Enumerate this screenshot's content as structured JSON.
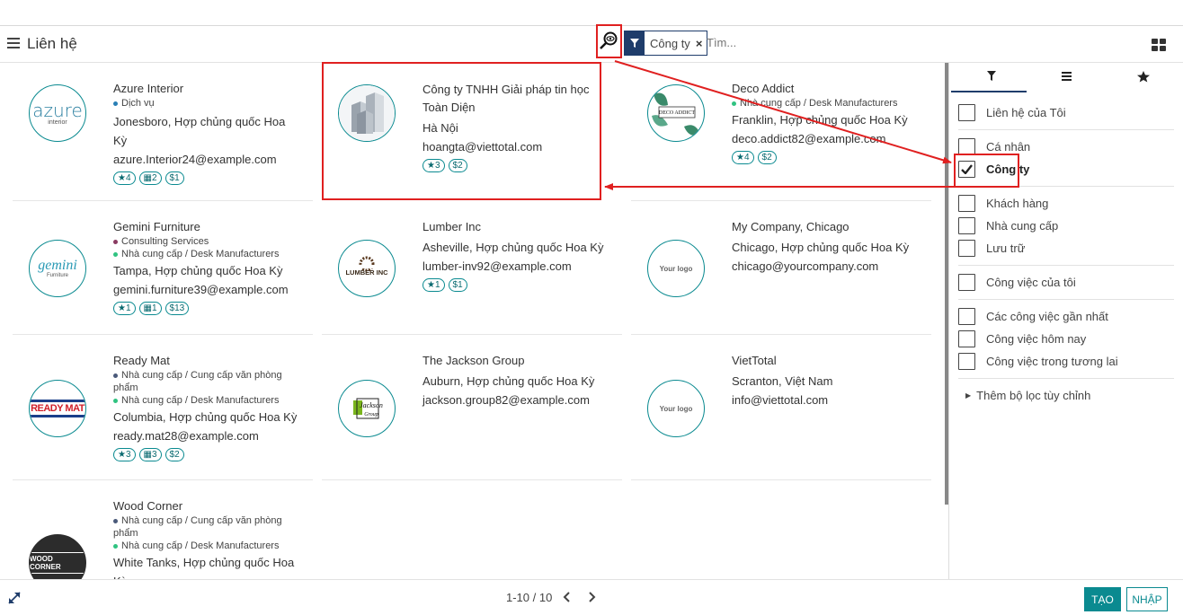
{
  "app": {
    "title": "Liên hệ"
  },
  "search": {
    "facet_label": "Công ty",
    "facet_remove": "×",
    "placeholder": "Tìm..."
  },
  "cards": [
    {
      "name": "Azure Interior",
      "tags": [
        {
          "text": "Dịch vụ",
          "color": "#2a7fb5"
        }
      ],
      "address": "Jonesboro, Hợp chủng quốc Hoa Kỳ",
      "email": "azure.Interior24@example.com",
      "badges": [
        "★4",
        "▦2",
        "$1"
      ],
      "logo_text": "azure",
      "logo_sub": "interior"
    },
    {
      "name": "Công ty TNHH Giải pháp tin học Toàn Diện",
      "tags": [],
      "address": "Hà Nội",
      "email": "hoangta@viettotal.com",
      "badges": [
        "★3",
        "$2"
      ],
      "logo_text": "",
      "logo_sub": ""
    },
    {
      "name": "Deco Addict",
      "tags": [
        {
          "text": "Nhà cung cấp / Desk Manufacturers",
          "color": "#30c381"
        }
      ],
      "address": "Franklin, Hợp chủng quốc Hoa Kỳ",
      "email": "deco.addict82@example.com",
      "badges": [
        "★4",
        "$2"
      ],
      "logo_text": "DECO ADDICT",
      "logo_sub": ""
    },
    {
      "name": "Gemini Furniture",
      "tags": [
        {
          "text": "Consulting Services",
          "color": "#8a3b62"
        },
        {
          "text": "Nhà cung cấp / Desk Manufacturers",
          "color": "#30c381"
        }
      ],
      "address": "Tampa, Hợp chủng quốc Hoa Kỳ",
      "email": "gemini.furniture39@example.com",
      "badges": [
        "★1",
        "▦1",
        "$13"
      ],
      "logo_text": "gemini",
      "logo_sub": "Furniture"
    },
    {
      "name": "Lumber Inc",
      "tags": [],
      "address": "Asheville, Hợp chủng quốc Hoa Kỳ",
      "email": "lumber-inv92@example.com",
      "badges": [
        "★1",
        "$1"
      ],
      "logo_text": "LUMBER INC",
      "logo_sub": ""
    },
    {
      "name": "My Company, Chicago",
      "tags": [],
      "address": "Chicago, Hợp chủng quốc Hoa Kỳ",
      "email": "chicago@yourcompany.com",
      "badges": [],
      "logo_text": "Your logo",
      "logo_sub": ""
    },
    {
      "name": "Ready Mat",
      "tags": [
        {
          "text": "Nhà cung cấp / Cung cấp văn phòng phẩm",
          "color": "#4a5a7a"
        },
        {
          "text": "Nhà cung cấp / Desk Manufacturers",
          "color": "#30c381"
        }
      ],
      "address": "Columbia, Hợp chủng quốc Hoa Kỳ",
      "email": "ready.mat28@example.com",
      "badges": [
        "★3",
        "▦3",
        "$2"
      ],
      "logo_text": "READY MAT",
      "logo_sub": ""
    },
    {
      "name": "The Jackson Group",
      "tags": [],
      "address": "Auburn, Hợp chủng quốc Hoa Kỳ",
      "email": "jackson.group82@example.com",
      "badges": [],
      "logo_text": "Jackson",
      "logo_sub": "Group"
    },
    {
      "name": "VietTotal",
      "tags": [],
      "address": "Scranton, Việt Nam",
      "email": "info@viettotal.com",
      "badges": [],
      "logo_text": "Your logo",
      "logo_sub": ""
    },
    {
      "name": "Wood Corner",
      "tags": [
        {
          "text": "Nhà cung cấp / Cung cấp văn phòng phẩm",
          "color": "#4a5a7a"
        },
        {
          "text": "Nhà cung cấp / Desk Manufacturers",
          "color": "#30c381"
        }
      ],
      "address": "White Tanks, Hợp chủng quốc Hoa Kỳ",
      "email": "",
      "badges": [],
      "logo_text": "WOOD CORNER",
      "logo_sub": ""
    }
  ],
  "filters": {
    "group1": [
      {
        "label": "Liên hệ của Tôi",
        "checked": false
      }
    ],
    "group2": [
      {
        "label": "Cá nhân",
        "checked": false
      },
      {
        "label": "Công ty",
        "checked": true
      }
    ],
    "group3": [
      {
        "label": "Khách hàng",
        "checked": false
      },
      {
        "label": "Nhà cung cấp",
        "checked": false
      },
      {
        "label": "Lưu trữ",
        "checked": false
      }
    ],
    "group4": [
      {
        "label": "Công việc của tôi",
        "checked": false
      }
    ],
    "group5": [
      {
        "label": "Các công việc gần nhất",
        "checked": false
      },
      {
        "label": "Công việc hôm nay",
        "checked": false
      },
      {
        "label": "Công việc trong tương lai",
        "checked": false
      }
    ],
    "custom": "Thêm bộ lọc tùy chỉnh"
  },
  "pager": {
    "text": "1-10 / 10"
  },
  "buttons": {
    "create": "TẠO",
    "import": "NHẬP"
  },
  "colors": {
    "accent": "#0a8a90",
    "nav": "#1f3d6b",
    "annotation": "#e02020"
  }
}
